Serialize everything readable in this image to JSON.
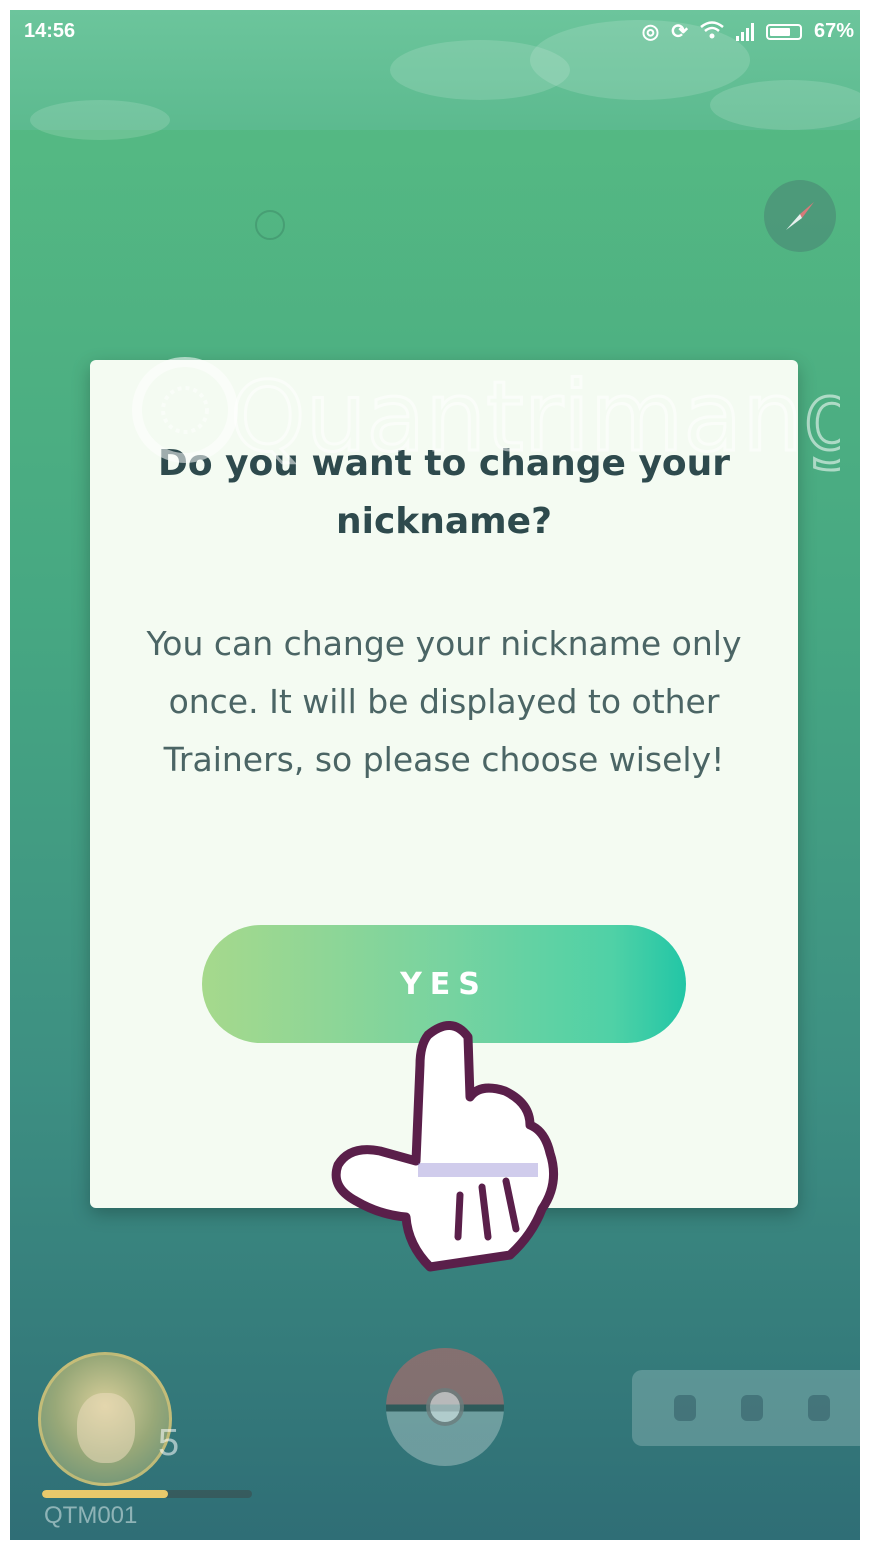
{
  "status_bar": {
    "time": "14:56",
    "battery_percent": "67%",
    "battery_level": 0.67
  },
  "dialog": {
    "title": "Do you want to change your nickname?",
    "message": "You can change your nickname only once. It will be displayed to other Trainers, so please choose wisely!",
    "yes_label": "YES"
  },
  "player": {
    "level": "5",
    "name": "QTM001",
    "xp_progress": 0.6
  },
  "watermark": {
    "brand": "Quantrimang"
  },
  "colors": {
    "background_top": "#58bd83",
    "background_bottom": "#2f6e76",
    "dialog_bg": "#f4fbf2",
    "title_text": "#2e4a4d",
    "button_start": "#a6d98c",
    "button_end": "#22c6a6"
  },
  "icons": {
    "compass": "compass-icon",
    "hand": "pointing-hand-icon",
    "pokeball": "pokeball-icon"
  }
}
